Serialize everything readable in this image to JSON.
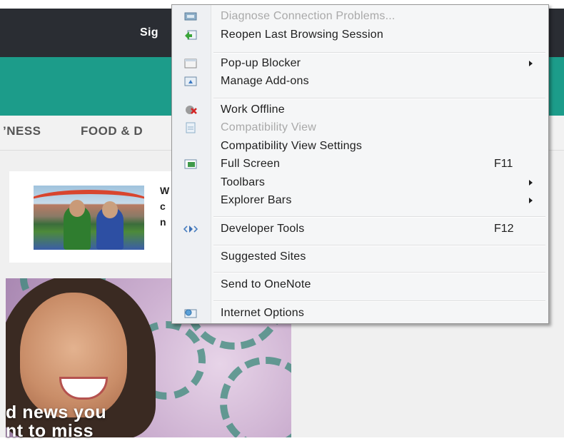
{
  "page": {
    "signin_label": "Sig",
    "nav_items": [
      "’NESS",
      "FOOD & D"
    ],
    "card_text_lines": [
      "W",
      "c",
      "n"
    ],
    "promo_text_lines": [
      "d news you",
      "nt to miss"
    ]
  },
  "menu": {
    "items": [
      {
        "label": "Diagnose Connection Problems...",
        "icon": "network-diagnose-icon",
        "disabled": true
      },
      {
        "label": "Reopen Last Browsing Session",
        "icon": "reopen-session-icon"
      },
      {
        "label": "Pop-up Blocker",
        "icon": "popup-blocker-icon",
        "submenu": true
      },
      {
        "label": "Manage Add-ons",
        "icon": "addons-icon"
      },
      {
        "label": "Work Offline",
        "icon": "work-offline-icon"
      },
      {
        "label": "Compatibility View",
        "icon": "compatibility-view-icon",
        "disabled": true
      },
      {
        "label": "Compatibility View Settings"
      },
      {
        "label": "Full Screen",
        "icon": "full-screen-icon",
        "shortcut": "F11"
      },
      {
        "label": "Toolbars",
        "submenu": true
      },
      {
        "label": "Explorer Bars",
        "submenu": true
      },
      {
        "label": "Developer Tools",
        "icon": "developer-tools-icon",
        "shortcut": "F12"
      },
      {
        "label": "Suggested Sites"
      },
      {
        "label": "Send to OneNote"
      },
      {
        "label": "Internet Options",
        "icon": "internet-options-icon"
      }
    ]
  },
  "colors": {
    "topbar": "#2a2d33",
    "teal_band": "#1c9c8a",
    "menu_bg": "#f5f6f7",
    "disabled_text": "#a9a9a9"
  }
}
